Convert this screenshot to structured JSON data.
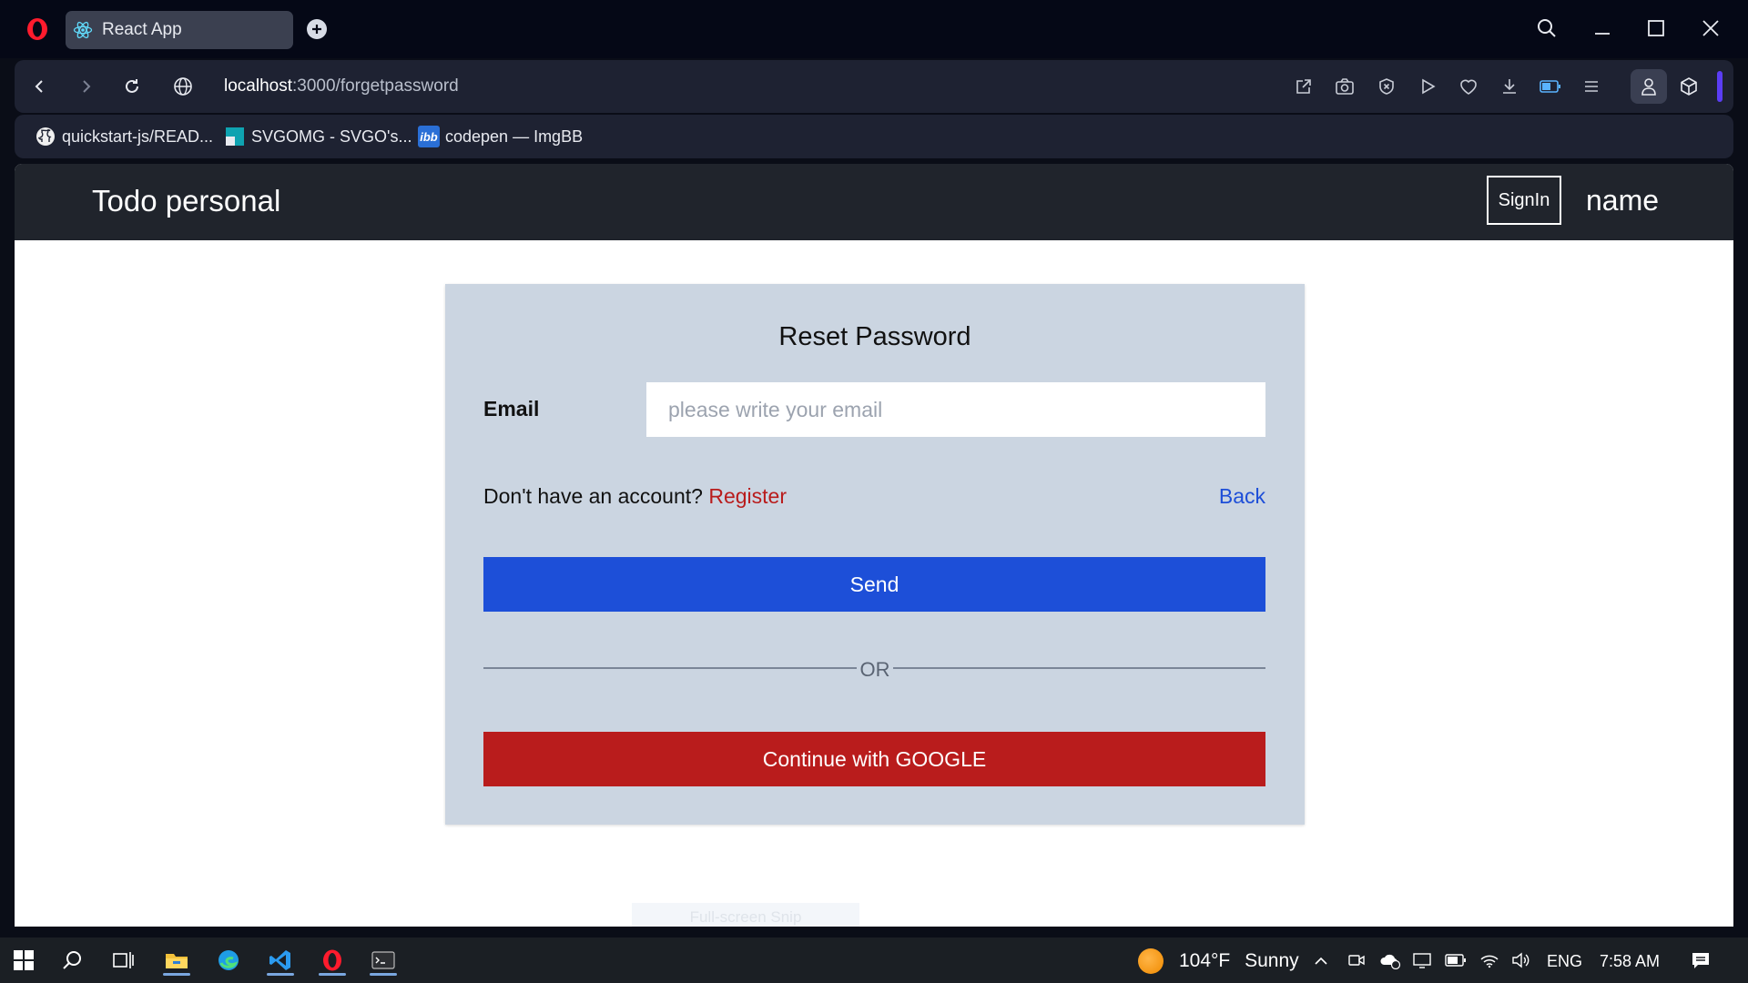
{
  "browser": {
    "tab_title": "React App",
    "url_host": "localhost",
    "url_rest": ":3000/forgetpassword",
    "bookmarks": [
      {
        "label": "quickstart-js/READ...",
        "icon": "github-icon"
      },
      {
        "label": "SVGOMG - SVGO's...",
        "icon": "svgomg-icon"
      },
      {
        "label": "codepen — ImgBB",
        "icon": "imgbb-icon"
      }
    ],
    "imgbb_icon_text": "ibb"
  },
  "app": {
    "brand": "Todo personal",
    "signin_label": "SignIn",
    "user_name": "name"
  },
  "form": {
    "title": "Reset Password",
    "email_label": "Email",
    "email_value": "",
    "email_placeholder": "please write your email",
    "no_account_text": "Don't have an account?",
    "register_label": "Register",
    "back_label": "Back",
    "send_label": "Send",
    "or_text": "OR",
    "google_label": "Continue with GOOGLE"
  },
  "overlay": {
    "snip_hint": "Full-screen Snip"
  },
  "taskbar": {
    "weather_temp": "104°F",
    "weather_cond": "Sunny",
    "language": "ENG",
    "time": "7:58 AM"
  },
  "colors": {
    "send_button": "#1d4fd8",
    "google_button": "#b91c1c",
    "register_link": "#b91c1c",
    "back_link": "#1d4ed8",
    "card_background": "#cbd5e1",
    "app_navbar": "#20242c"
  }
}
